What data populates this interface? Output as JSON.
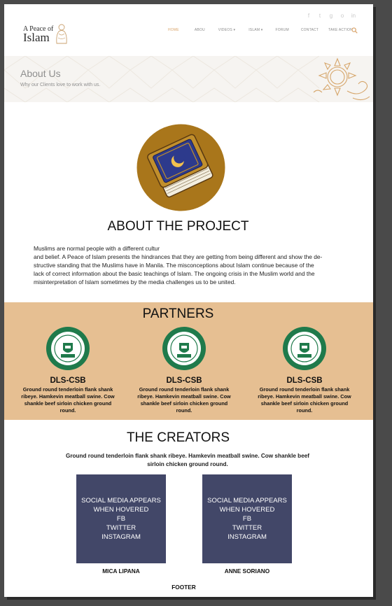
{
  "header": {
    "social_icons": [
      "facebook-icon",
      "twitter-icon",
      "google-plus-icon",
      "dribbble-icon",
      "linkedin-icon"
    ],
    "social_glyphs": [
      "f",
      "t",
      "g",
      "o",
      "in"
    ],
    "logo": {
      "line1": "A Peace of",
      "line2": "Islam"
    },
    "nav": [
      {
        "label": "HOME",
        "active": true
      },
      {
        "label": "ABOU",
        "active": false
      },
      {
        "label": "VIDEOS ▾",
        "active": false
      },
      {
        "label": "ISLAM ▾",
        "active": false
      },
      {
        "label": "FORUM",
        "active": false
      },
      {
        "label": "CONTACT",
        "active": false
      },
      {
        "label": "TAKE ACTION",
        "active": false
      }
    ],
    "search_icon": "search-icon"
  },
  "banner": {
    "title": "About Us",
    "subtitle": "Why our Clients love to work with us."
  },
  "about": {
    "title": "ABOUT THE PROJECT",
    "line1": "Muslims are normal people with a different cultur",
    "line2": "and belief. A Peace of Islam presents the hindrances that they are getting from being different and show the de-",
    "line3": "structive standing that the Muslims have in Manila. The misconceptions about Islam continue because of the",
    "line4": "lack of correct information about the basic teachings of Islam. The ongoing crisis in the Muslim world and the",
    "line5": "misinterpretation of Islam sometimes by the media challenges us to be united."
  },
  "partners": {
    "title": "PARTNERS",
    "items": [
      {
        "name": "DLS-CSB",
        "desc": "Ground round tenderloin flank shank ribeye. Hamkevin meatball swine. Cow shankle beef sirloin chicken ground round.",
        "seal_text": "DE LA SALLE COLLEGE OF SAINT BENILDE",
        "seal_year": "1988"
      },
      {
        "name": "DLS-CSB",
        "desc": "Ground round tenderloin flank shank ribeye. Hamkevin meatball swine. Cow shankle beef sirloin chicken ground round.",
        "seal_text": "DE LA SALLE COLLEGE OF SAINT BENILDE",
        "seal_year": "1988"
      },
      {
        "name": "DLS-CSB",
        "desc": "Ground round tenderloin flank shank ribeye. Hamkevin meatball swine. Cow shankle beef sirloin chicken ground round.",
        "seal_text": "DE LA SALLE COLLEGE OF SAINT BENILDE",
        "seal_year": "1988"
      }
    ]
  },
  "creators": {
    "title": "THE CREATORS",
    "text": "Ground round tenderloin flank shank ribeye. Hamkevin meatball swine. Cow shankle beef sirloin chicken ground round.",
    "items": [
      {
        "name": "MICA LIPANA",
        "card_lines": [
          "SOCIAL MEDIA APPEARS",
          "WHEN HOVERED",
          "FB",
          "TWITTER",
          "INSTAGRAM"
        ]
      },
      {
        "name": "ANNE SORIANO",
        "card_lines": [
          "SOCIAL MEDIA APPEARS",
          "WHEN HOVERED",
          "FB",
          "TWITTER",
          "INSTAGRAM"
        ]
      }
    ]
  },
  "footer": {
    "label": "FOOTER"
  },
  "colors": {
    "accent": "#d9a46a",
    "partners_bg": "#e6bf92",
    "card_bg": "#424768",
    "seal_green": "#1f7a4b",
    "book_circle": "#a9761b"
  }
}
